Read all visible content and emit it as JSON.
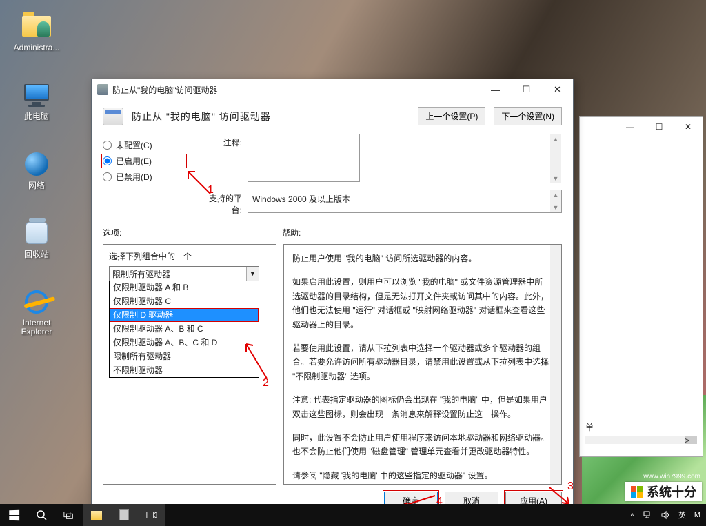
{
  "desktop": {
    "icons": [
      {
        "label": "Administra..."
      },
      {
        "label": "此电脑"
      },
      {
        "label": "网络"
      },
      {
        "label": "回收站"
      },
      {
        "label": "Internet Explorer"
      }
    ]
  },
  "bg_window": {
    "minimize": "—",
    "maximize": "☐",
    "close": "✕",
    "bottom_label": "单",
    "scroll_right": ">"
  },
  "dialog": {
    "window_title": "防止从\"我的电脑\"访问驱动器",
    "header_title": "防止从 \"我的电脑\" 访问驱动器",
    "prev_btn": "上一个设置(P)",
    "next_btn": "下一个设置(N)",
    "radios": {
      "unconfigured": "未配置(C)",
      "enabled": "已启用(E)",
      "disabled": "已禁用(D)"
    },
    "comment_label": "注释:",
    "comment_value": "",
    "platform_label": "支持的平台:",
    "platform_value": "Windows 2000 及以上版本",
    "options_label": "选项:",
    "help_label": "帮助:",
    "options": {
      "prompt": "选择下列组合中的一个",
      "selected": "限制所有驱动器",
      "items": [
        "仅限制驱动器 A 和 B",
        "仅限制驱动器 C",
        "仅限制 D 驱动器",
        "仅限制驱动器 A、B 和 C",
        "仅限制驱动器 A、B、C 和 D",
        "限制所有驱动器",
        "不限制驱动器"
      ],
      "selected_index": 2
    },
    "help": {
      "p1": "防止用户使用 \"我的电脑\" 访问所选驱动器的内容。",
      "p2": "如果启用此设置，则用户可以浏览 \"我的电脑\" 或文件资源管理器中所选驱动器的目录结构，但是无法打开文件夹或访问其中的内容。此外，他们也无法使用 \"运行\" 对话框或 \"映射网络驱动器\" 对话框来查看这些驱动器上的目录。",
      "p3": "若要使用此设置，请从下拉列表中选择一个驱动器或多个驱动器的组合。若要允许访问所有驱动器目录，请禁用此设置或从下拉列表中选择 \"不限制驱动器\" 选项。",
      "p4": "注意: 代表指定驱动器的图标仍会出现在 \"我的电脑\" 中，但是如果用户双击这些图标，则会出现一条消息来解释设置防止这一操作。",
      "p5": " 同时，此设置不会防止用户使用程序来访问本地驱动器和网络驱动器。也不会防止他们使用 \"磁盘管理\" 管理单元查看并更改驱动器特性。",
      "p6": "请参阅 \"隐藏 '我的电脑' 中的这些指定的驱动器\" 设置。"
    },
    "footer": {
      "ok": "确定",
      "cancel": "取消",
      "apply": "应用(A)"
    },
    "win_buttons": {
      "minimize": "—",
      "maximize": "☐",
      "close": "✕"
    }
  },
  "annotations": {
    "n1": "1",
    "n2": "2",
    "n3": "3",
    "n4": "4"
  },
  "tray": {
    "ime1": "英",
    "ime2": "M"
  },
  "watermark": {
    "text": "系统十分",
    "url": "www.win7999.com"
  }
}
